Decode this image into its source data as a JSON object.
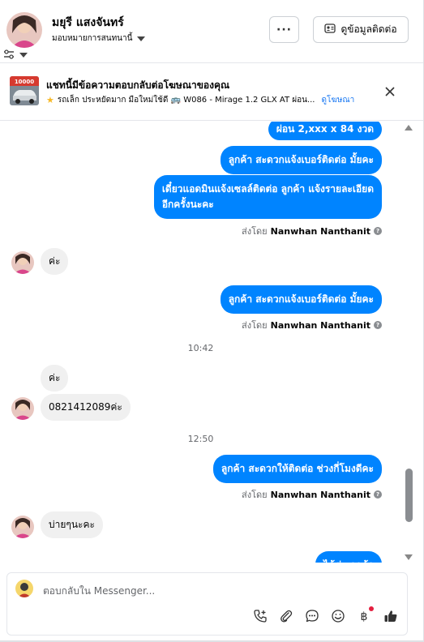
{
  "header": {
    "contact_name": "มยุรี แสงจันทร์",
    "assign_label": "มอบหมายการสนทนานี้",
    "more_label": "···",
    "contact_info_label": "ดูข้อมูลติดต่อ"
  },
  "ad": {
    "title": "แชทนี้มีข้อความตอบกลับต่อโฆษณาของคุณ",
    "description": "รถเล็ก ประหยัดมาก มือใหม่ใช้ดี 🚌 W086 - Mirage 1.2 GLX AT ผ่อน...",
    "view_ad_link": "ดูโฆษณา",
    "thumb_price": "10000"
  },
  "messages": {
    "m1": "ผ่อน 2,xxx x 84 งวด",
    "m2": "ลูกค้า สะดวกแจ้งเบอร์ติดต่อ มั้ยคะ",
    "m3_line1": "เดี๋ยวแอดมินแจ้งเซลล์ติดต่อ ลูกค้า แจ้งรายละเอียด",
    "m3_line2": "อีกครั้งนะคะ",
    "sent_by_prefix": "ส่งโดย",
    "agent_name": "Nanwhan Nanthanit",
    "in1": "ค่ะ",
    "m4": "ลูกค้า สะดวกแจ้งเบอร์ติดต่อ มั้ยคะ",
    "time1": "10:42",
    "in2": "ค่ะ",
    "in3": "0821412089ค่ะ",
    "time2": "12:50",
    "m5": "ลูกค้า  สะดวกให้ติดต่อ ช่วงกี่โมงดีคะ",
    "in4": "บ่ายๆนะคะ",
    "m6_partial": "ได้ค่ะ ลูกค้า"
  },
  "composer": {
    "placeholder": "ตอบกลับใน Messenger..."
  },
  "colors": {
    "accent": "#0084ff",
    "link": "#1877f2",
    "incoming": "#f0f0f0"
  }
}
